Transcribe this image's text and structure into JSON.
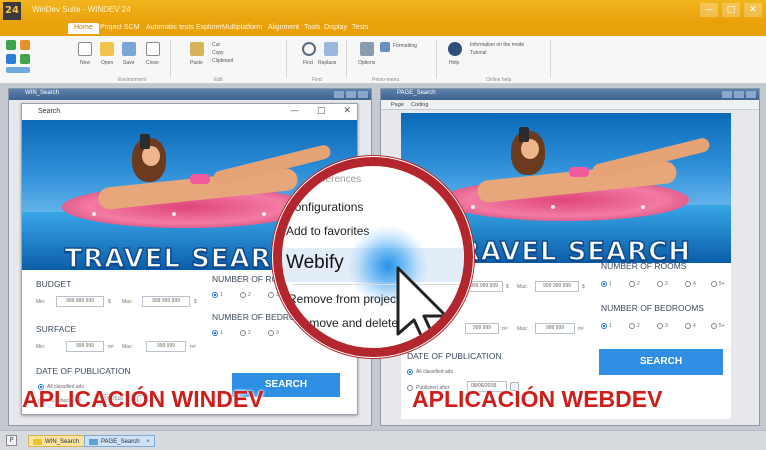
{
  "app": {
    "logo": "24",
    "title": "WinDev Suite - WINDEV 24",
    "window_controls": [
      "—",
      "□",
      "✕"
    ]
  },
  "menu": {
    "tabs": [
      "Home",
      "Project",
      "SCM",
      "Automatic tests",
      "Explorer",
      "Multiplatform",
      "Alignment",
      "Tools",
      "Display",
      "Tests"
    ],
    "active": "Home"
  },
  "ribbon": {
    "labels": [
      "New",
      "Open",
      "Save",
      "Close",
      "Paste",
      "Cut",
      "Copy",
      "Clipboard",
      "Find",
      "Replace",
      "Options",
      "Formatting",
      "Help",
      "Information on the mode",
      "Tutorial"
    ],
    "groups": [
      "Environment",
      "Edit",
      "Find",
      "Perso-menu",
      "Online help"
    ]
  },
  "panels": {
    "windev": {
      "title": "WIN_Search",
      "dialog_title": "Search",
      "dialog_controls": [
        "—",
        "□",
        "✕"
      ]
    },
    "webdev": {
      "title": "PAGE_Search",
      "tabs": [
        "Page",
        "Coding"
      ]
    }
  },
  "form": {
    "hero_title": "TRAVEL SEARCH",
    "budget_label": "BUDGET",
    "min_label": "Min:",
    "max_label": "Max:",
    "budget_min": "999 999 999",
    "budget_max": "999 999 999",
    "budget_unit": "$",
    "surface_label": "SURFACE",
    "surface_min": "999 999",
    "surface_max": "999 999",
    "surface_unit": "m²",
    "rooms_label": "NUMBER OF ROOMS",
    "bedrooms_label": "NUMBER OF BEDROOMS",
    "room_options": [
      "1",
      "2",
      "3",
      "4",
      "5+"
    ],
    "publication_label": "DATE OF PUBLICATION",
    "all_ads_label": "All classified ads",
    "published_after_label": "Published after:",
    "date_value": "09/06/2018",
    "search_button": "SEARCH"
  },
  "context_menu": {
    "items": [
      "References",
      "Configurations",
      "Add to favorites",
      "Webify",
      "Remove from project",
      "Remove and delete"
    ],
    "highlighted": "Webify"
  },
  "captions": {
    "left": "APLICACIÓN WINDEV",
    "right": "APLICACIÓN WEBDEV"
  },
  "statusbar": {
    "icon": "P",
    "tabs": [
      {
        "label": "WIN_Search",
        "color": "#f0c331"
      },
      {
        "label": "PAGE_Search",
        "color": "#5da0dc"
      }
    ]
  }
}
